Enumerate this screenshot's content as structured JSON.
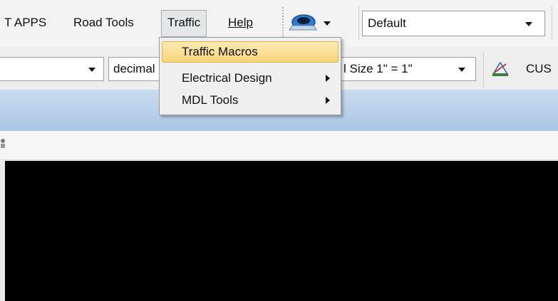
{
  "menubar": {
    "items": [
      {
        "label": "T APPS"
      },
      {
        "label": "Road Tools"
      },
      {
        "label": "Traffic"
      },
      {
        "label": "Help"
      }
    ]
  },
  "toolbar": {
    "view_combo_value": "Default"
  },
  "toolbar2": {
    "level_combo_value": "",
    "decimal_combo_value": "decimal",
    "scale_combo_value": "l Size 1\" = 1\"",
    "cus_label": "CUS"
  },
  "traffic_menu": {
    "items": [
      {
        "label": "Traffic Macros",
        "highlighted": true,
        "has_submenu": false
      },
      {
        "label": "Electrical Design",
        "highlighted": false,
        "has_submenu": true
      },
      {
        "label": "MDL Tools",
        "highlighted": false,
        "has_submenu": true
      }
    ]
  },
  "colors": {
    "highlight": "#f8d57a",
    "title_strip": "#b9d1ea",
    "viewport": "#000000"
  },
  "icons": [
    "view-display-icon",
    "dimension-style-icon",
    "small-tool-icon"
  ]
}
